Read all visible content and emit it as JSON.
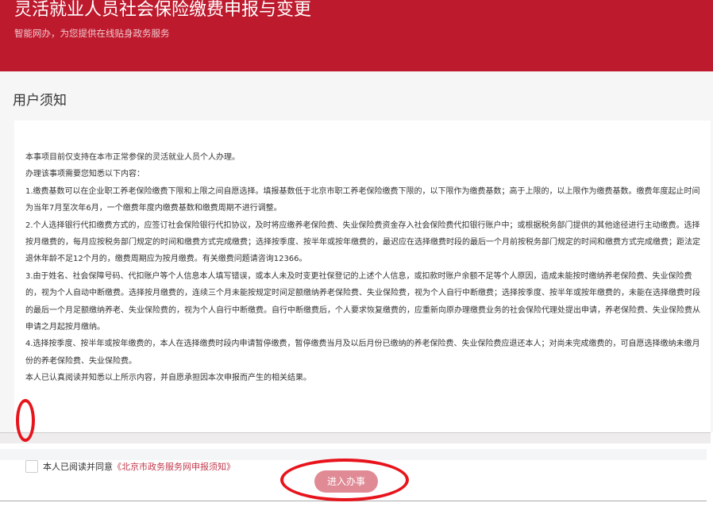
{
  "header": {
    "title": "灵活就业人员社会保险缴费申报与变更",
    "subtitle": "智能网办，为您提供在线贴身政务服务"
  },
  "notice": {
    "title": "用户须知",
    "paragraphs": [
      "本事项目前仅支持在本市正常参保的灵活就业人员个人办理。",
      "办理该事项需要您知悉以下内容：",
      "1.缴费基数可以在企业职工养老保险缴费下限和上限之间自愿选择。填报基数低于北京市职工养老保险缴费下限的，以下限作为缴费基数；高于上限的，以上限作为缴费基数。缴费年度起止时间为当年7月至次年6月，一个缴费年度内缴费基数和缴费周期不进行调整。",
      "2.个人选择银行代扣缴费方式的，应签订社会保险银行代扣协议，及时将应缴养老保险费、失业保险费资金存入社会保险费代扣银行账户中；或根据税务部门提供的其他途径进行主动缴费。选择按月缴费的，每月应按税务部门规定的时间和缴费方式完成缴费；选择按季度、按半年或按年缴费的，最迟应在选择缴费时段的最后一个月前按税务部门规定的时间和缴费方式完成缴费；距法定退休年龄不足12个月的，缴费周期应为按月缴费。有关缴费问题请咨询12366。",
      "3.由于姓名、社会保障号码、代扣账户等个人信息本人填写错误，或本人未及时变更社保登记的上述个人信息，或扣款时账户余额不足等个人原因，造成未能按时缴纳养老保险费、失业保险费的，视为个人自动中断缴费。选择按月缴费的，连续三个月未能按规定时间足额缴纳养老保险费、失业保险费，视为个人自行中断缴费；选择按季度、按半年或按年缴费的，未能在选择缴费时段的最后一个月足额缴纳养老、失业保险费的，视为个人自行中断缴费。自行中断缴费后，个人要求恢复缴费的，应重新向原办理缴费业务的社会保险代理处提出申请，养老保险费、失业保险费从申请之月起按月缴纳。",
      "4.选择按季度、按半年或按年缴费的，本人在选择缴费时段内申请暂停缴费，暂停缴费当月及以后月份已缴纳的养老保险费、失业保险费应退还本人；对尚未完成缴费的，可自愿选择缴纳未缴月份的养老保险费、失业保险费。",
      "本人已认真阅读并知悉以上所示内容，并自愿承担因本次申报而产生的相关结果。"
    ],
    "agree_label": "本人已阅读并同意",
    "agree_link": "《北京市政务服务网申报须知》"
  },
  "action": {
    "enter_label": "进入办事"
  },
  "colors": {
    "brand": "#be1a2e",
    "annotation": "#e8141c"
  }
}
